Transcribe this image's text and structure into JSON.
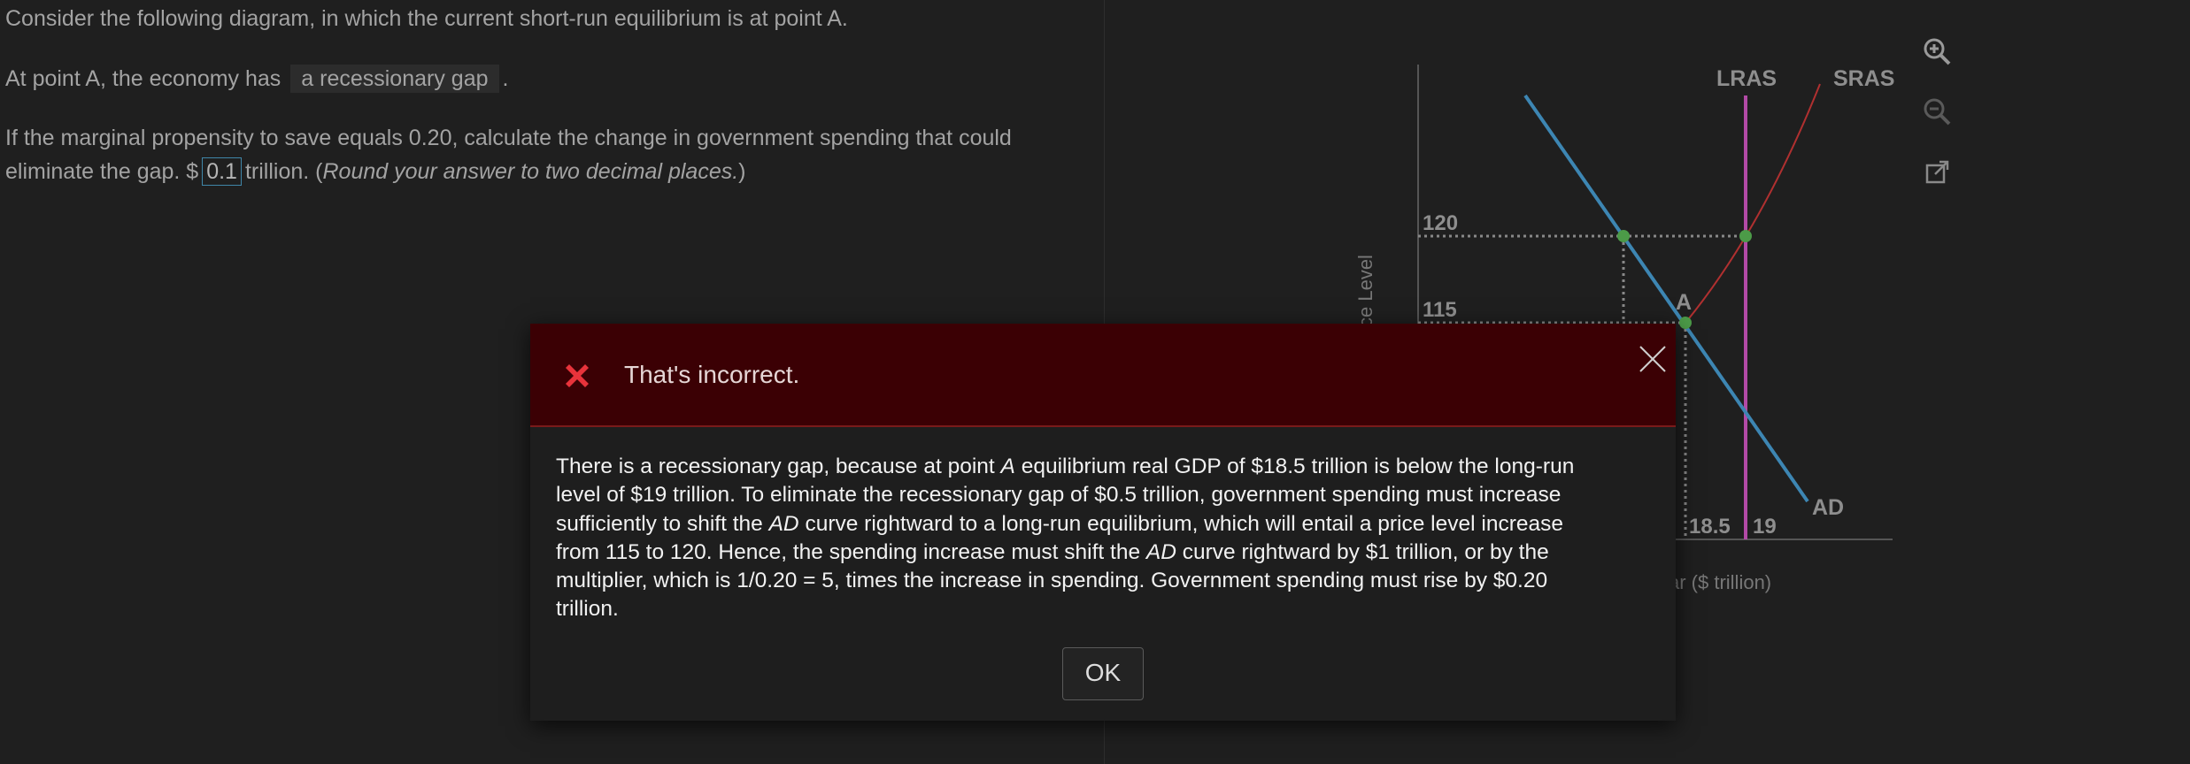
{
  "question": {
    "line1": "Consider the following diagram, in which the current short-run equilibrium is at point A.",
    "line2_prefix": "At point A, the economy has",
    "line2_answer": "a recessionary gap",
    "line2_suffix": ".",
    "line3": "If the marginal propensity to save equals 0.20, calculate the change in government spending that could",
    "line4_prefix": "eliminate the gap. $",
    "line4_input_value": "0.1",
    "line4_mid": "trillion. (",
    "line4_italic": "Round your answer to two decimal places.",
    "line4_end": ")"
  },
  "graph": {
    "y_axis_label": "ce Level",
    "x_axis_label": "ar ($ trillion)",
    "curve_labels": {
      "lras": "LRAS",
      "sras": "SRAS",
      "ad": "AD"
    },
    "point_label": "A",
    "y_ticks": [
      "120",
      "115"
    ],
    "x_ticks": [
      "18.5",
      "19"
    ],
    "colors": {
      "ad": "#3d86b3",
      "lras": "#b24aa6",
      "sras": "#b03030",
      "points": "#4c9b48"
    }
  },
  "tools": {
    "zoom_in": "zoom-in-icon",
    "zoom_out": "zoom-out-icon",
    "popout": "external-link-icon"
  },
  "modal": {
    "title": "That's incorrect.",
    "body": {
      "l1a": "There is a recessionary gap, because at point ",
      "l1b": "A",
      "l1c": " equilibrium real GDP of $18.5 trillion is below the long-run",
      "l2": "level of $19 trillion. To eliminate the recessionary gap of $0.5 trillion, government spending must increase",
      "l3a": "sufficiently to shift the ",
      "l3b": "AD",
      "l3c": " curve rightward to a long-run equilibrium, which will entail a price level increase",
      "l4a": "from 115 to 120. Hence, the spending increase must shift the ",
      "l4b": "AD",
      "l4c": " curve rightward by $1 trillion, or by the",
      "l5": "multiplier, which is 1/0.20 = 5, times the increase in spending. Government spending must rise by $0.20",
      "l6": "trillion."
    },
    "ok_label": "OK",
    "colors": {
      "header_bg": "#3b0004",
      "error_icon": "#e8333b"
    }
  }
}
